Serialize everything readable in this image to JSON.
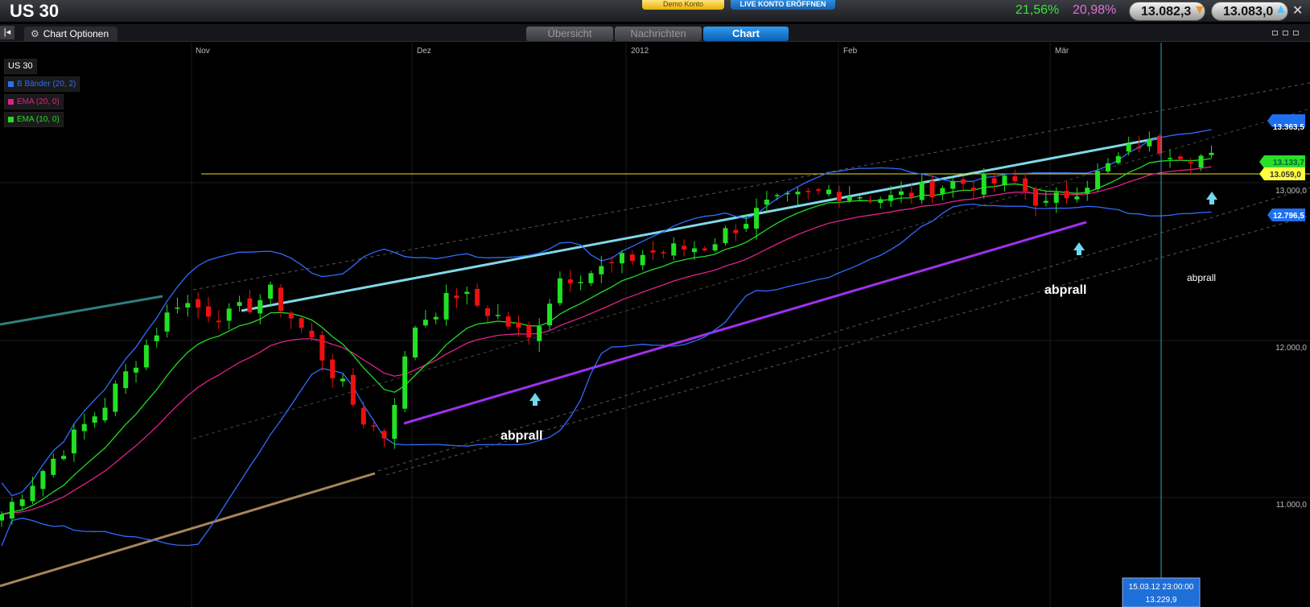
{
  "header": {
    "symbol": "US 30",
    "demo_button": "Demo Konto",
    "live_button": "LIVE KONTO ERÖFFNEN",
    "pct_green": "21,56%",
    "pct_pink": "20,98%",
    "sell_price": "13.082,3",
    "buy_price": "13.083,0"
  },
  "subbar": {
    "chart_options": "Chart Optionen",
    "tabs": [
      "Übersicht",
      "Nachrichten",
      "Chart"
    ],
    "active_tab": "Chart"
  },
  "legend": {
    "title": "US 30",
    "items": [
      {
        "label": "B Bänder (20, 2)",
        "color": "#2f6cff"
      },
      {
        "label": "EMA (20, 0)",
        "color": "#e0208c"
      },
      {
        "label": "EMA (10, 0)",
        "color": "#22dd22"
      }
    ]
  },
  "chart_data": {
    "type": "candlestick",
    "x_labels": [
      "Nov",
      "Dez",
      "2012",
      "Feb",
      "Mär"
    ],
    "y_ticks": [
      "13.000,0",
      "12.000,0",
      "11.000,0"
    ],
    "y_tick_values": [
      13000,
      12000,
      11000
    ],
    "price_labels": [
      {
        "text": "13.363,5",
        "value": 13363.5,
        "color": "#1e6ff0"
      },
      {
        "text": "13.133,7",
        "value": 13133.7,
        "color": "#2adf2a"
      },
      {
        "text": "13.059,0",
        "value": 13059.0,
        "color": "#ffff40"
      },
      {
        "text": "12.796,5",
        "value": 12796.5,
        "color": "#1e6ff0"
      }
    ],
    "crosshair": {
      "date": "15.03.12 23:00:00",
      "value": "13.229,9"
    },
    "annotations": [
      "abprall",
      "abprall",
      "abprall"
    ],
    "horizontal_line": 13059
  }
}
